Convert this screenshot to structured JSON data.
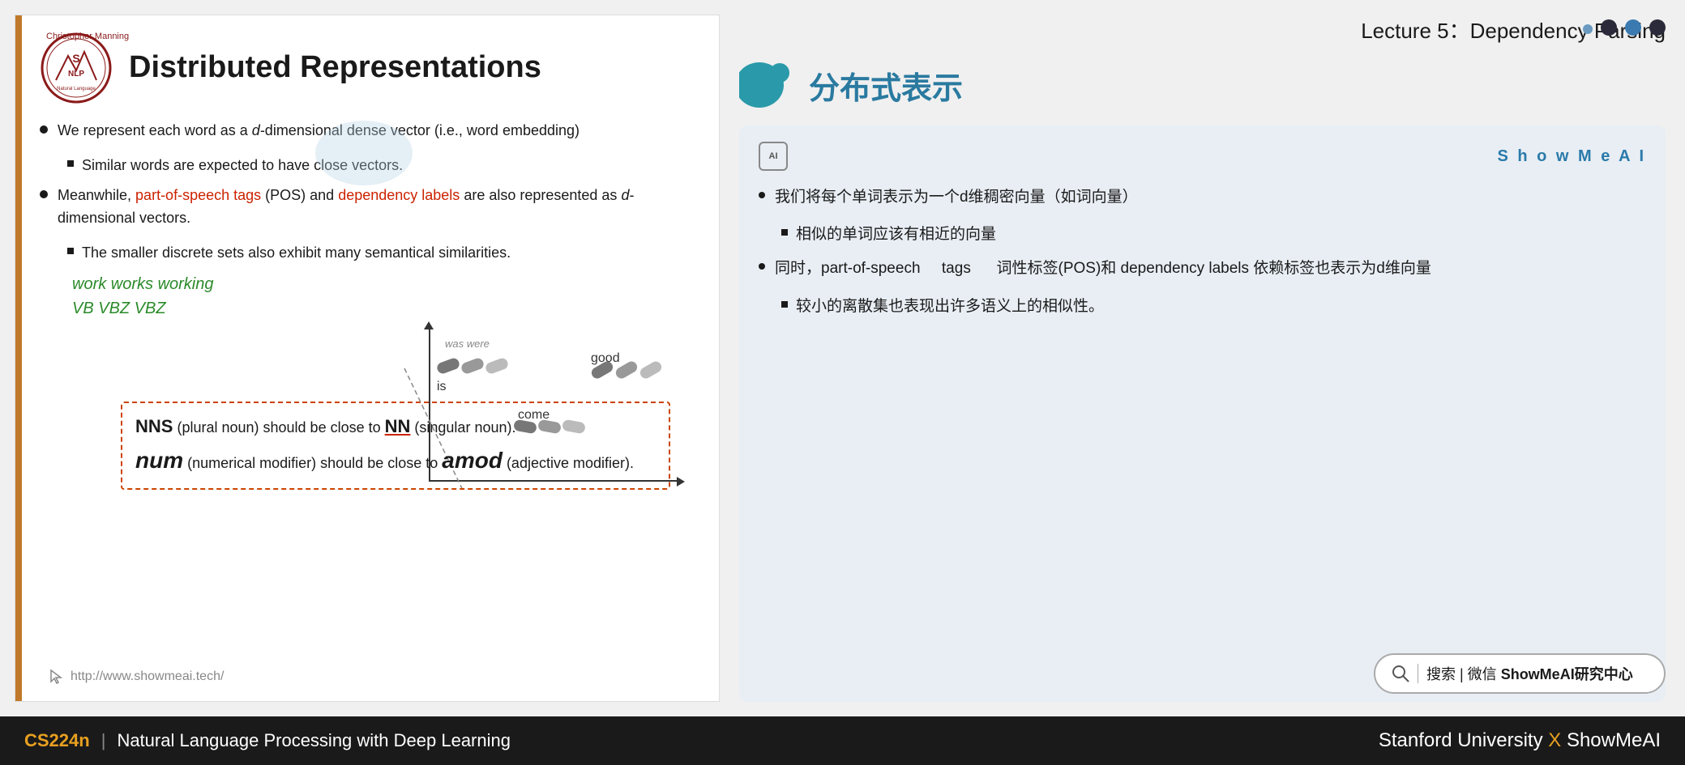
{
  "lecture": {
    "title": "Lecture 5：Dependency Parsing"
  },
  "slide": {
    "professor": "Christopher Manning",
    "logo_text": "S NLP",
    "title": "Distributed Representations",
    "bullets": [
      {
        "text": "We represent each word as a d-dimensional dense vector (i.e., word embedding)",
        "sub": [
          "Similar words are expected to have close vectors."
        ]
      },
      {
        "text": "Meanwhile, part-of-speech tags (POS) and dependency labels are also represented as d-dimensional vectors.",
        "sub": [
          "The smaller discrete sets also exhibit many semantical similarities."
        ]
      }
    ],
    "handwriting": {
      "line1": "work   works   working",
      "line2": "VB      VBZ     VBZ"
    },
    "dashed_box": {
      "line1_pre": "NNS",
      "line1_mid": " (plural noun) should be close to ",
      "line1_post": "NN",
      "line1_end": " (singular noun).",
      "line2_pre": "num",
      "line2_mid": " (numerical modifier) should be close to ",
      "line2_post": "amod",
      "line2_end": " (adjective modifier)."
    },
    "url": "http://www.showmeai.tech/",
    "word_labels": [
      "is",
      "come",
      "good"
    ],
    "wasl_labels": [
      "was",
      "were"
    ]
  },
  "right_panel": {
    "section_title": "分布式表示",
    "showmeai_label": "S h o w M e A I",
    "ai_icon": "AI",
    "bullets": [
      {
        "text": "我们将每个单词表示为一个d维稠密向量（如词向量）",
        "sub": [
          "相似的单词应该有相近的向量"
        ]
      },
      {
        "text": "同时，part-of-speech    tags    词性标签(POS)和 dependency labels 依赖标签也表示为d维向量",
        "sub": [
          "较小的离散集也表现出许多语义上的相似性。"
        ]
      }
    ],
    "search_text": "搜索 | 微信 ShowMeAI研究中心"
  },
  "footer": {
    "course_code": "CS224n",
    "separator": "|",
    "description": "Natural Language Processing with Deep Learning",
    "right_text": "Stanford University",
    "x_symbol": "X",
    "brand": "ShowMeAI"
  }
}
